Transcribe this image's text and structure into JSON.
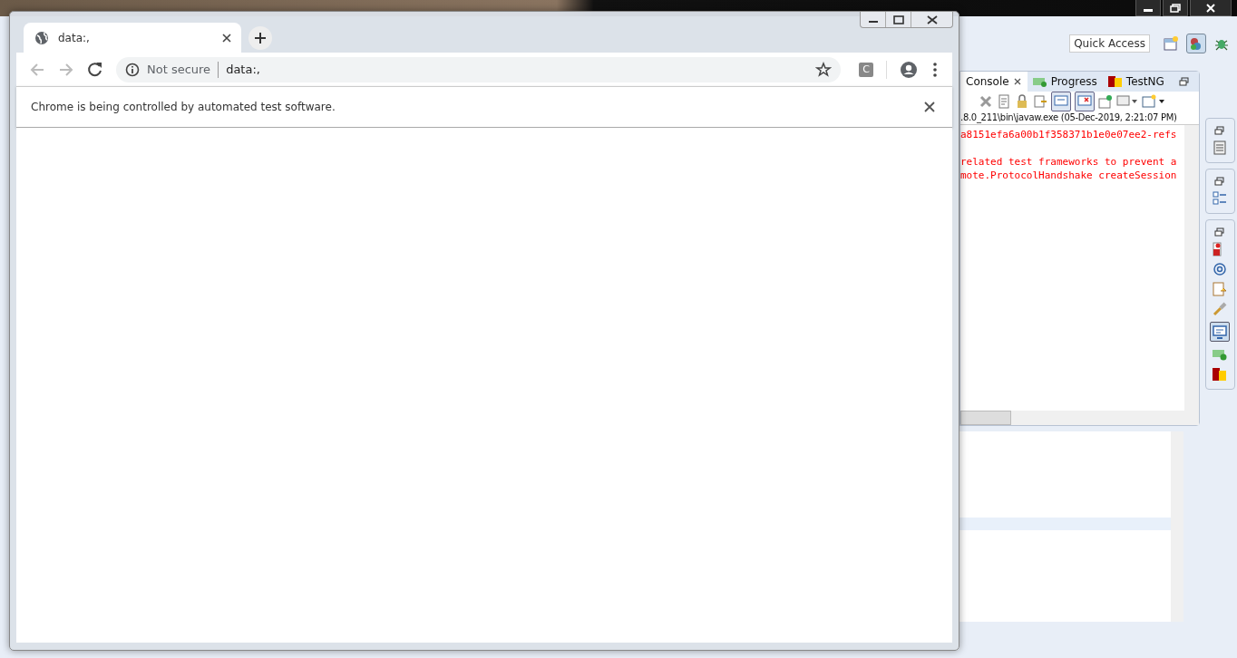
{
  "eclipse": {
    "quick_access": "Quick Access",
    "console_view": {
      "tabs": [
        {
          "label": "Console",
          "selected": true
        },
        {
          "label": "Progress",
          "selected": false
        },
        {
          "label": "TestNG",
          "selected": false
        }
      ],
      "process_label": ".8.0_211\\bin\\javaw.exe (05-Dec-2019, 2:21:07 PM)",
      "blocks": [
        [
          "a8151efa6a00b1f358371b1e0e07ee2-refs"
        ],
        [
          "related test frameworks to prevent a",
          "mote.ProtocolHandshake createSession"
        ]
      ]
    }
  },
  "chrome": {
    "tab": {
      "title": "data:,"
    },
    "security": "Not secure",
    "url": "data:,",
    "extension": "C",
    "infobar": "Chrome is being controlled by automated test software."
  }
}
